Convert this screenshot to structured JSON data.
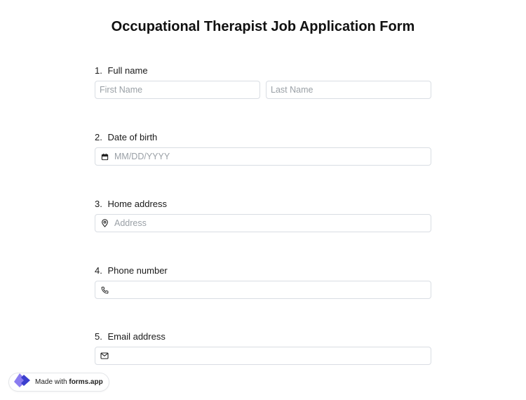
{
  "form": {
    "title": "Occupational Therapist Job Application Form"
  },
  "questions": [
    {
      "number": "1.",
      "label": "Full name",
      "first_placeholder": "First Name",
      "last_placeholder": "Last Name"
    },
    {
      "number": "2.",
      "label": "Date of birth",
      "placeholder": "MM/DD/YYYY",
      "icon": "calendar-icon"
    },
    {
      "number": "3.",
      "label": "Home address",
      "placeholder": "Address",
      "icon": "location-pin-icon"
    },
    {
      "number": "4.",
      "label": "Phone number",
      "placeholder": "",
      "icon": "phone-icon"
    },
    {
      "number": "5.",
      "label": "Email address",
      "placeholder": "",
      "icon": "envelope-icon"
    }
  ],
  "badge": {
    "prefix": "Made with",
    "brand": "forms.app",
    "icon": "forms-app-logo-icon",
    "logo_colors": [
      "#3b3fce",
      "#8a7cf0"
    ]
  },
  "colors": {
    "border": "#d9dde3",
    "placeholder": "#9aa0a6",
    "text": "#1a1a1a"
  }
}
